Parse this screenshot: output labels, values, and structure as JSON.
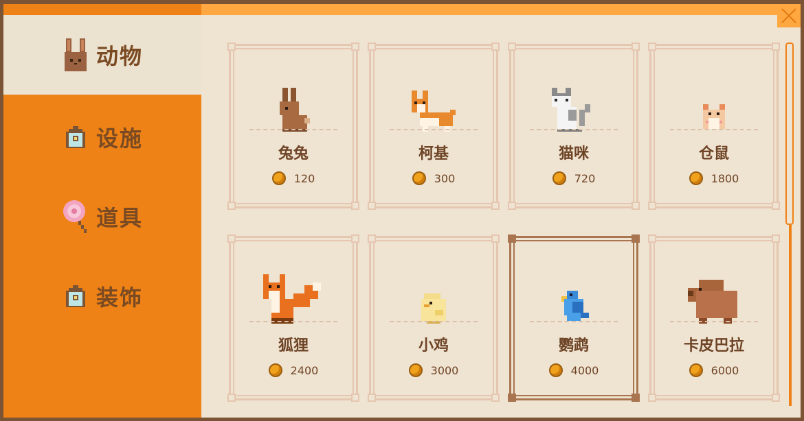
{
  "tabs": [
    {
      "label": "动物",
      "icon": "rabbit-icon",
      "active": true
    },
    {
      "label": "设施",
      "icon": "house-icon",
      "active": false
    },
    {
      "label": "道具",
      "icon": "lollipop-icon",
      "active": false
    },
    {
      "label": "装饰",
      "icon": "house-icon",
      "active": false
    }
  ],
  "items": [
    {
      "name": "兔兔",
      "price": "120",
      "icon": "rabbit-icon"
    },
    {
      "name": "柯基",
      "price": "300",
      "icon": "corgi-icon"
    },
    {
      "name": "猫咪",
      "price": "720",
      "icon": "cat-icon"
    },
    {
      "name": "仓鼠",
      "price": "1800",
      "icon": "hamster-icon"
    },
    {
      "name": "狐狸",
      "price": "2400",
      "icon": "fox-icon"
    },
    {
      "name": "小鸡",
      "price": "3000",
      "icon": "chick-icon"
    },
    {
      "name": "鹦鹉",
      "price": "4000",
      "icon": "parrot-icon",
      "selected": true
    },
    {
      "name": "卡皮巴拉",
      "price": "6000",
      "icon": "capybara-icon"
    }
  ],
  "colors": {
    "accent": "#ef8216",
    "panel": "#efe3d1",
    "text": "#6e4426",
    "coin": "#f0a21c"
  }
}
